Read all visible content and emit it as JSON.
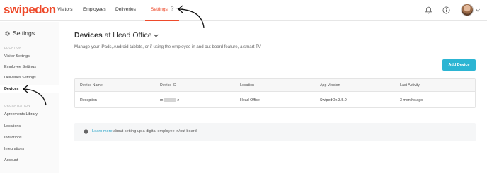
{
  "app": {
    "logo": "swipedon"
  },
  "nav": {
    "visitors": "Visitors",
    "employees": "Employees",
    "deliveries": "Deliveries",
    "settings": "Settings",
    "more": "? ~ ~"
  },
  "sidebar": {
    "title": "Settings",
    "sections": [
      {
        "label": "LOCATION",
        "items": [
          "Visitor Settings",
          "Employee Settings",
          "Deliveries Settings",
          "Devices"
        ]
      },
      {
        "label": "ORGANIZATION",
        "items": [
          "Agreements Library",
          "Locations",
          "Inductions",
          "Integrations",
          "Account"
        ]
      }
    ],
    "active": "Devices"
  },
  "main": {
    "title_prefix": "Devices",
    "title_at": " at ",
    "location": "Head Office",
    "subtitle": "Manage your iPads, Android tablets, or if using the employee in and out board feature, a smart TV",
    "add_button": "Add Device"
  },
  "table": {
    "columns": [
      "Device Name",
      "Device ID",
      "Location",
      "App Version",
      "Last Activity"
    ],
    "rows": [
      {
        "device_name": "Reception",
        "device_id_start": "m",
        "device_id_end": "z",
        "location": "Head Office",
        "app_version": "SwipedOn 3.5.0",
        "last_activity": "3 months ago"
      }
    ]
  },
  "info": {
    "link": "Learn more",
    "text": " about setting up a digital employee in/out board"
  },
  "colors": {
    "brand": "#ee4a2b",
    "accent": "#2cb5d3"
  },
  "icons": {
    "bell": "bell-icon",
    "info": "info-icon",
    "gear": "gear-icon"
  }
}
